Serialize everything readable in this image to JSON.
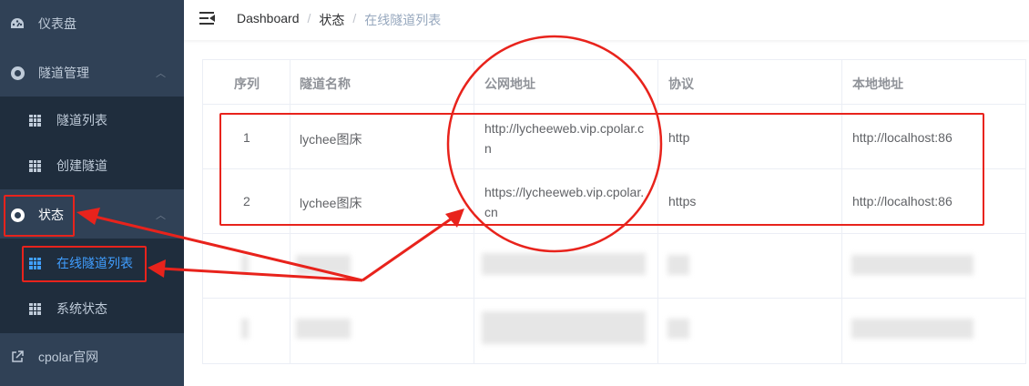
{
  "sidebar": {
    "items": [
      {
        "label": "仪表盘",
        "icon": "dashboard-icon"
      },
      {
        "label": "隧道管理",
        "icon": "tunnel-icon"
      },
      {
        "label": "状态",
        "icon": "status-icon"
      },
      {
        "label": "cpolar官网",
        "icon": "external-link-icon"
      }
    ],
    "tunnel_sub": [
      {
        "label": "隧道列表",
        "icon": "grid-icon"
      },
      {
        "label": "创建隧道",
        "icon": "grid-icon"
      }
    ],
    "status_sub": [
      {
        "label": "在线隧道列表",
        "icon": "grid-icon",
        "active": true
      },
      {
        "label": "系统状态",
        "icon": "grid-icon"
      }
    ]
  },
  "breadcrumb": [
    "Dashboard",
    "状态",
    "在线隧道列表"
  ],
  "table": {
    "headers": [
      "序列",
      "隧道名称",
      "公网地址",
      "协议",
      "本地地址"
    ],
    "rows": [
      {
        "index": "1",
        "name": "lychee图床",
        "url_line1": "http://lycheeweb.vip.cpolar.c",
        "url_line2": "n",
        "protocol": "http",
        "local": "http://localhost:86"
      },
      {
        "index": "2",
        "name": "lychee图床",
        "url_line1": "https://lycheeweb.vip.cpolar.",
        "url_line2": "cn",
        "protocol": "https",
        "local": "http://localhost:86"
      }
    ]
  },
  "colors": {
    "annotation": "#e8231c",
    "sidebar_bg": "#304156",
    "active": "#409eff"
  }
}
